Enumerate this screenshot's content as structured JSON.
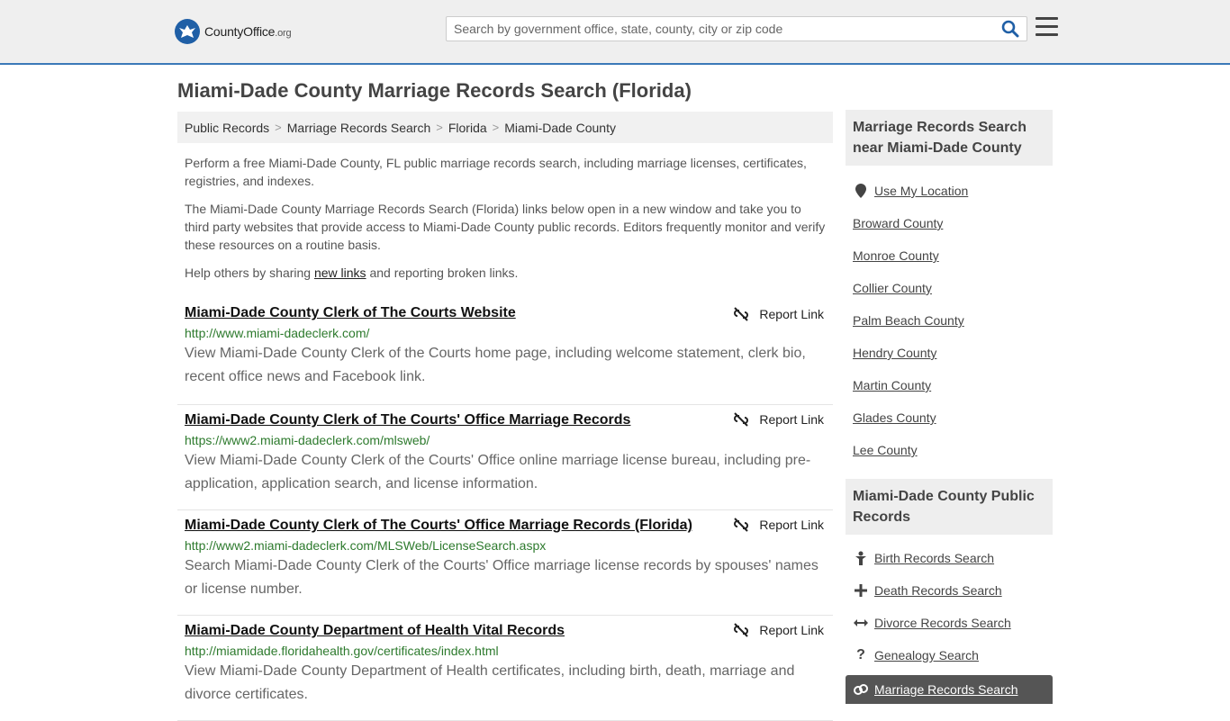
{
  "header": {
    "logo_brand": "CountyOffice",
    "logo_tld": ".org",
    "search_placeholder": "Search by government office, state, county, city or zip code"
  },
  "page_title": "Miami-Dade County Marriage Records Search (Florida)",
  "breadcrumb": [
    "Public Records",
    "Marriage Records Search",
    "Florida",
    "Miami-Dade County"
  ],
  "intro": {
    "p1": "Perform a free Miami-Dade County, FL public marriage records search, including marriage licenses, certificates, registries, and indexes.",
    "p2": "The Miami-Dade County Marriage Records Search (Florida) links below open in a new window and take you to third party websites that provide access to Miami-Dade County public records. Editors frequently monitor and verify these resources on a routine basis.",
    "p3_before": "Help others by sharing ",
    "p3_link": "new links",
    "p3_after": " and reporting broken links."
  },
  "report_label": "Report Link",
  "results": [
    {
      "title": "Miami-Dade County Clerk of The Courts Website",
      "url": "http://www.miami-dadeclerk.com/",
      "desc": "View Miami-Dade County Clerk of the Courts home page, including welcome statement, clerk bio, recent office news and Facebook link."
    },
    {
      "title": "Miami-Dade County Clerk of The Courts' Office Marriage Records",
      "url": "https://www2.miami-dadeclerk.com/mlsweb/",
      "desc": "View Miami-Dade County Clerk of the Courts' Office online marriage license bureau, including pre-application, application search, and license information."
    },
    {
      "title": "Miami-Dade County Clerk of The Courts' Office Marriage Records (Florida)",
      "url": "http://www2.miami-dadeclerk.com/MLSWeb/LicenseSearch.aspx",
      "desc": "Search Miami-Dade County Clerk of the Courts' Office marriage license records by spouses' names or license number."
    },
    {
      "title": "Miami-Dade County Department of Health Vital Records",
      "url": "http://miamidade.floridahealth.gov/certificates/index.html",
      "desc": "View Miami-Dade County Department of Health certificates, including birth, death, marriage and divorce certificates."
    }
  ],
  "sidebar": {
    "nearby_title": "Marriage Records Search near Miami-Dade County",
    "use_location": "Use My Location",
    "nearby": [
      "Broward County",
      "Monroe County",
      "Collier County",
      "Palm Beach County",
      "Hendry County",
      "Martin County",
      "Glades County",
      "Lee County"
    ],
    "public_title": "Miami-Dade County Public Records",
    "public": [
      {
        "label": "Birth Records Search",
        "icon": "baby-icon"
      },
      {
        "label": "Death Records Search",
        "icon": "cross-icon"
      },
      {
        "label": "Divorce Records Search",
        "icon": "split-arrows-icon"
      },
      {
        "label": "Genealogy Search",
        "icon": "question-icon"
      },
      {
        "label": "Marriage Records Search",
        "icon": "rings-icon"
      }
    ]
  }
}
